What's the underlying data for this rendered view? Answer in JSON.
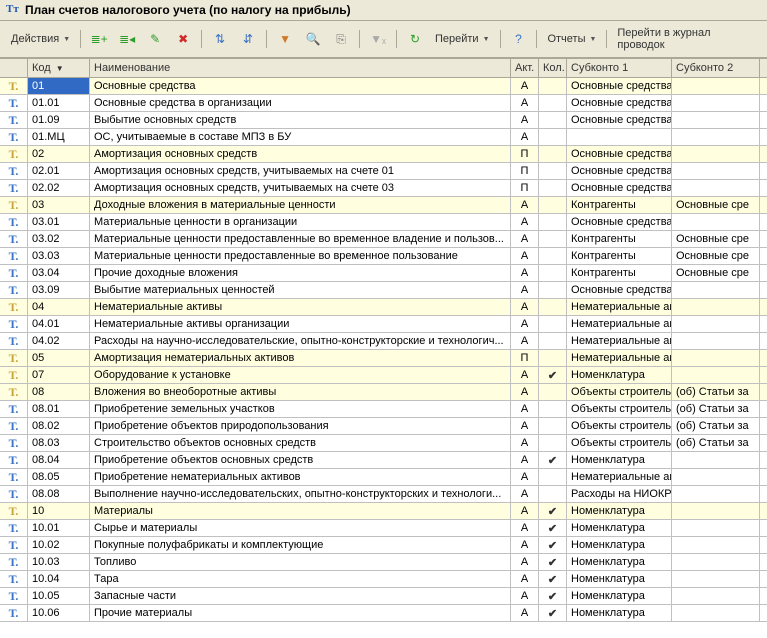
{
  "window": {
    "title": "План счетов налогового учета (по налогу на прибыль)"
  },
  "toolbar": {
    "actions": "Действия",
    "goto": "Перейти",
    "reports": "Отчеты",
    "journal": "Перейти в журнал проводок"
  },
  "columns": {
    "icon": "",
    "code": "Код",
    "name": "Наименование",
    "akt": "Акт.",
    "kol": "Кол.",
    "sub1": "Субконто 1",
    "sub2": "Субконто 2"
  },
  "rows": [
    {
      "alt": true,
      "sel": true,
      "code": "01",
      "name": "Основные средства",
      "akt": "А",
      "kol": "",
      "sub1": "Основные средства",
      "sub2": ""
    },
    {
      "alt": false,
      "code": "01.01",
      "name": "Основные средства в организации",
      "akt": "А",
      "kol": "",
      "sub1": "Основные средства",
      "sub2": ""
    },
    {
      "alt": false,
      "code": "01.09",
      "name": "Выбытие основных средств",
      "akt": "А",
      "kol": "",
      "sub1": "Основные средства",
      "sub2": ""
    },
    {
      "alt": false,
      "code": "01.МЦ",
      "name": "ОС, учитываемые в составе МПЗ в БУ",
      "akt": "А",
      "kol": "",
      "sub1": "",
      "sub2": ""
    },
    {
      "alt": true,
      "code": "02",
      "name": "Амортизация основных средств",
      "akt": "П",
      "kol": "",
      "sub1": "Основные средства",
      "sub2": ""
    },
    {
      "alt": false,
      "code": "02.01",
      "name": "Амортизация основных средств, учитываемых на счете 01",
      "akt": "П",
      "kol": "",
      "sub1": "Основные средства",
      "sub2": ""
    },
    {
      "alt": false,
      "code": "02.02",
      "name": "Амортизация основных средств, учитываемых на счете 03",
      "akt": "П",
      "kol": "",
      "sub1": "Основные средства",
      "sub2": ""
    },
    {
      "alt": true,
      "code": "03",
      "name": "Доходные вложения в материальные ценности",
      "akt": "А",
      "kol": "",
      "sub1": "Контрагенты",
      "sub2": "Основные сре"
    },
    {
      "alt": false,
      "code": "03.01",
      "name": "Материальные ценности в организации",
      "akt": "А",
      "kol": "",
      "sub1": "Основные средства",
      "sub2": ""
    },
    {
      "alt": false,
      "code": "03.02",
      "name": "Материальные ценности предоставленные во временное владение и пользов...",
      "akt": "А",
      "kol": "",
      "sub1": "Контрагенты",
      "sub2": "Основные сре"
    },
    {
      "alt": false,
      "code": "03.03",
      "name": "Материальные ценности предоставленные во временное пользование",
      "akt": "А",
      "kol": "",
      "sub1": "Контрагенты",
      "sub2": "Основные сре"
    },
    {
      "alt": false,
      "code": "03.04",
      "name": "Прочие доходные вложения",
      "akt": "А",
      "kol": "",
      "sub1": "Контрагенты",
      "sub2": "Основные сре"
    },
    {
      "alt": false,
      "code": "03.09",
      "name": "Выбытие материальных ценностей",
      "akt": "А",
      "kol": "",
      "sub1": "Основные средства",
      "sub2": ""
    },
    {
      "alt": true,
      "code": "04",
      "name": "Нематериальные активы",
      "akt": "А",
      "kol": "",
      "sub1": "Нематериальные ак...",
      "sub2": ""
    },
    {
      "alt": false,
      "code": "04.01",
      "name": "Нематериальные активы организации",
      "akt": "А",
      "kol": "",
      "sub1": "Нематериальные ак...",
      "sub2": ""
    },
    {
      "alt": false,
      "code": "04.02",
      "name": "Расходы на научно-исследовательские, опытно-конструкторские и технологич...",
      "akt": "А",
      "kol": "",
      "sub1": "Нематериальные ак...",
      "sub2": ""
    },
    {
      "alt": true,
      "code": "05",
      "name": "Амортизация нематериальных активов",
      "akt": "П",
      "kol": "",
      "sub1": "Нематериальные ак...",
      "sub2": ""
    },
    {
      "alt": true,
      "code": "07",
      "name": "Оборудование к установке",
      "akt": "А",
      "kol": "✔",
      "sub1": "Номенклатура",
      "sub2": ""
    },
    {
      "alt": true,
      "code": "08",
      "name": "Вложения во внеоборотные активы",
      "akt": "А",
      "kol": "",
      "sub1": "Объекты строитель...",
      "sub2": "(об) Статьи за"
    },
    {
      "alt": false,
      "code": "08.01",
      "name": "Приобретение земельных участков",
      "akt": "А",
      "kol": "",
      "sub1": "Объекты строитель...",
      "sub2": "(об) Статьи за"
    },
    {
      "alt": false,
      "code": "08.02",
      "name": "Приобретение объектов природопользования",
      "akt": "А",
      "kol": "",
      "sub1": "Объекты строитель...",
      "sub2": "(об) Статьи за"
    },
    {
      "alt": false,
      "code": "08.03",
      "name": "Строительство объектов основных средств",
      "akt": "А",
      "kol": "",
      "sub1": "Объекты строитель...",
      "sub2": "(об) Статьи за"
    },
    {
      "alt": false,
      "code": "08.04",
      "name": "Приобретение объектов основных средств",
      "akt": "А",
      "kol": "✔",
      "sub1": "Номенклатура",
      "sub2": ""
    },
    {
      "alt": false,
      "code": "08.05",
      "name": "Приобретение нематериальных активов",
      "akt": "А",
      "kol": "",
      "sub1": "Нематериальные ак...",
      "sub2": ""
    },
    {
      "alt": false,
      "code": "08.08",
      "name": "Выполнение научно-исследовательских, опытно-конструкторских и технологи...",
      "akt": "А",
      "kol": "",
      "sub1": "Расходы на НИОКР",
      "sub2": ""
    },
    {
      "alt": true,
      "code": "10",
      "name": "Материалы",
      "akt": "А",
      "kol": "✔",
      "sub1": "Номенклатура",
      "sub2": ""
    },
    {
      "alt": false,
      "code": "10.01",
      "name": "Сырье и материалы",
      "akt": "А",
      "kol": "✔",
      "sub1": "Номенклатура",
      "sub2": ""
    },
    {
      "alt": false,
      "code": "10.02",
      "name": "Покупные полуфабрикаты и комплектующие",
      "akt": "А",
      "kol": "✔",
      "sub1": "Номенклатура",
      "sub2": ""
    },
    {
      "alt": false,
      "code": "10.03",
      "name": "Топливо",
      "akt": "А",
      "kol": "✔",
      "sub1": "Номенклатура",
      "sub2": ""
    },
    {
      "alt": false,
      "code": "10.04",
      "name": "Тара",
      "akt": "А",
      "kol": "✔",
      "sub1": "Номенклатура",
      "sub2": ""
    },
    {
      "alt": false,
      "code": "10.05",
      "name": "Запасные части",
      "akt": "А",
      "kol": "✔",
      "sub1": "Номенклатура",
      "sub2": ""
    },
    {
      "alt": false,
      "code": "10.06",
      "name": "Прочие материалы",
      "akt": "А",
      "kol": "✔",
      "sub1": "Номенклатура",
      "sub2": ""
    }
  ]
}
